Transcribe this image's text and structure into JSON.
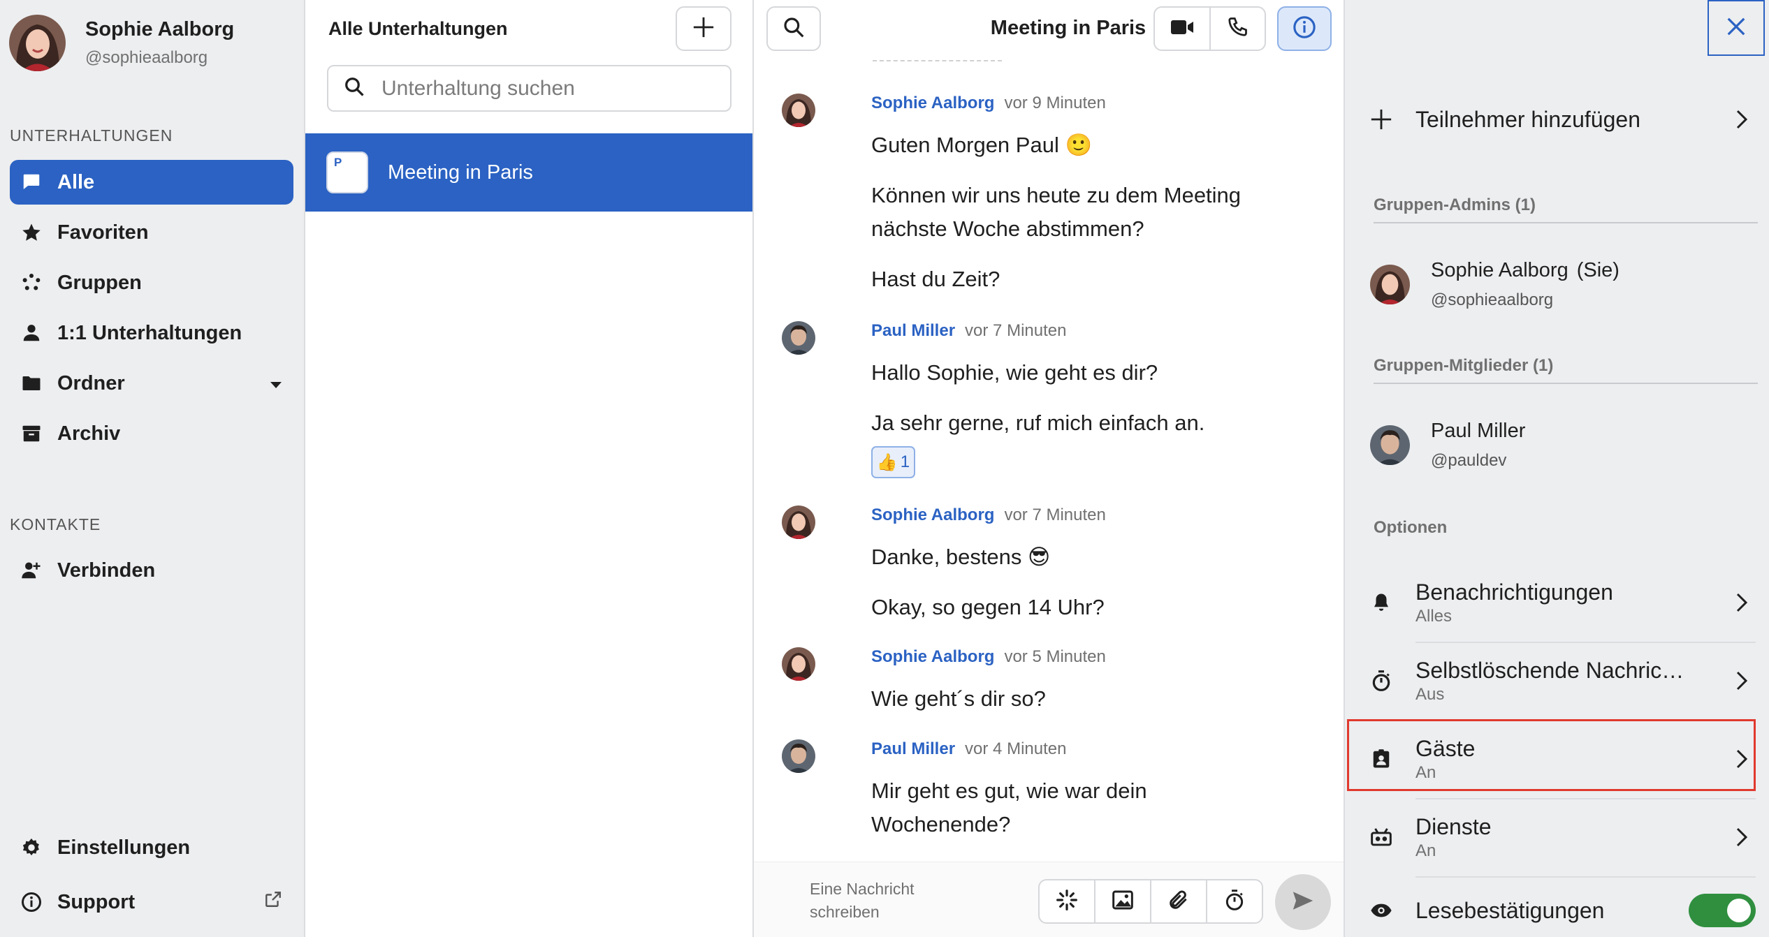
{
  "user": {
    "name": "Sophie Aalborg",
    "handle": "@sophieaalborg"
  },
  "sidebar": {
    "conversations_label": "UNTERHALTUNGEN",
    "items": [
      {
        "label": "Alle",
        "icon": "chat-icon"
      },
      {
        "label": "Favoriten",
        "icon": "star-icon"
      },
      {
        "label": "Gruppen",
        "icon": "groups-icon"
      },
      {
        "label": "1:1 Unterhaltungen",
        "icon": "person-icon"
      },
      {
        "label": "Ordner",
        "icon": "folder-icon"
      },
      {
        "label": "Archiv",
        "icon": "archive-icon"
      }
    ],
    "contacts_label": "KONTAKTE",
    "connect_label": "Verbinden",
    "settings_label": "Einstellungen",
    "support_label": "Support"
  },
  "conversation_list": {
    "title": "Alle Unterhaltungen",
    "search_placeholder": "Unterhaltung suchen",
    "items": [
      {
        "name": "Meeting in Paris",
        "initial": "P"
      }
    ]
  },
  "chat": {
    "title": "Meeting in Paris",
    "messages": [
      {
        "author": "Sophie Aalborg",
        "time": "vor 9 Minuten",
        "lines": [
          "Guten Morgen Paul 🙂",
          "Können wir uns heute zu dem Meeting",
          "nächste Woche abstimmen?",
          "Hast du Zeit?"
        ]
      },
      {
        "author": "Paul Miller",
        "time": "vor 7 Minuten",
        "lines": [
          "Hallo Sophie, wie geht es dir?",
          "Ja sehr gerne, ruf mich einfach an."
        ],
        "reaction": {
          "emoji": "👍",
          "count": "1"
        }
      },
      {
        "author": "Sophie Aalborg",
        "time": "vor 7 Minuten",
        "lines": [
          "Danke, bestens 😎",
          "Okay, so gegen 14 Uhr?"
        ]
      },
      {
        "author": "Sophie Aalborg",
        "time": "vor 5 Minuten",
        "lines": [
          "Wie geht´s dir so?"
        ]
      },
      {
        "author": "Paul Miller",
        "time": "vor 4 Minuten",
        "lines": [
          "Mir geht es gut, wie war dein",
          "Wochenende?"
        ]
      }
    ],
    "composer_placeholder": "Eine Nachricht schreiben"
  },
  "info_panel": {
    "add_participants": "Teilnehmer hinzufügen",
    "admins_label": "Gruppen-Admins (1)",
    "admins": [
      {
        "name": "Sophie Aalborg",
        "suffix": "(Sie)",
        "handle": "@sophieaalborg"
      }
    ],
    "members_label": "Gruppen-Mitglieder (1)",
    "members": [
      {
        "name": "Paul Miller",
        "handle": "@pauldev"
      }
    ],
    "options_label": "Optionen",
    "options": [
      {
        "title": "Benachrichtigungen",
        "value": "Alles",
        "icon": "bell-icon"
      },
      {
        "title": "Selbstlöschende Nachrichten",
        "value": "Aus",
        "icon": "timer-icon"
      },
      {
        "title": "Gäste",
        "value": "An",
        "icon": "guest-badge-icon"
      },
      {
        "title": "Dienste",
        "value": "An",
        "icon": "service-robot-icon"
      },
      {
        "title": "Lesebestätigungen",
        "icon": "eye-icon",
        "toggle_on": true
      }
    ]
  },
  "colors": {
    "accent": "#2b62c3",
    "toggle_on": "#2f8f3f",
    "highlight": "#e0392e"
  }
}
